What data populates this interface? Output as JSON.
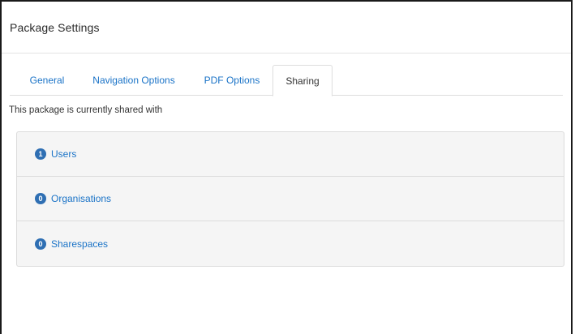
{
  "dialog": {
    "title": "Package Settings"
  },
  "tabs": [
    {
      "label": "General",
      "active": false
    },
    {
      "label": "Navigation Options",
      "active": false
    },
    {
      "label": "PDF Options",
      "active": false
    },
    {
      "label": "Sharing",
      "active": true
    }
  ],
  "sharing": {
    "intro": "This package is currently shared with",
    "items": [
      {
        "count": "1",
        "label": "Users"
      },
      {
        "count": "0",
        "label": "Organisations"
      },
      {
        "count": "0",
        "label": "Sharespaces"
      }
    ]
  },
  "colors": {
    "link": "#1a73c7",
    "badge": "#2f6fb3",
    "panel_bg": "#f5f5f5"
  }
}
